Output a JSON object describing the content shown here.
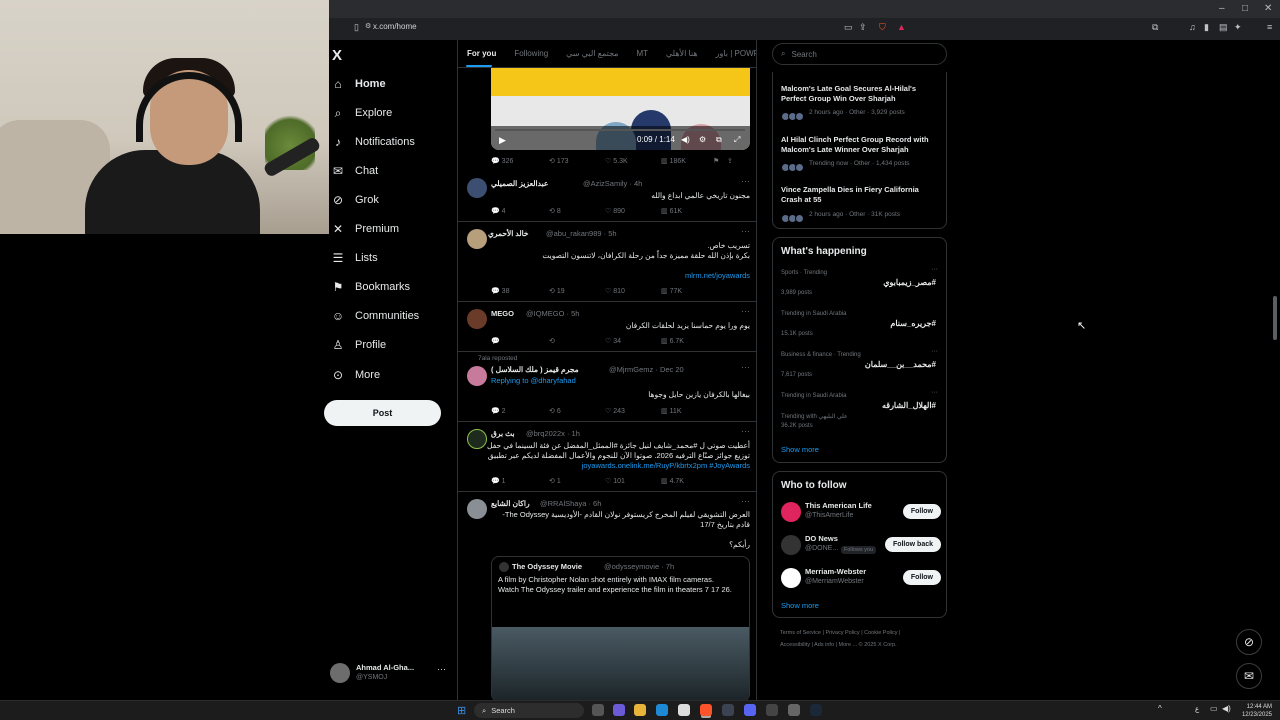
{
  "browser": {
    "url": "x.com/home"
  },
  "nav": {
    "logo": "X",
    "items": [
      {
        "label": "Home",
        "icon": "home-icon"
      },
      {
        "label": "Explore",
        "icon": "search-icon"
      },
      {
        "label": "Notifications",
        "icon": "bell-icon",
        "badge": "1"
      },
      {
        "label": "Chat",
        "icon": "mail-icon"
      },
      {
        "label": "Grok",
        "icon": "grok-icon"
      },
      {
        "label": "Premium",
        "icon": "x-icon"
      },
      {
        "label": "Lists",
        "icon": "list-icon"
      },
      {
        "label": "Bookmarks",
        "icon": "bookmark-icon"
      },
      {
        "label": "Communities",
        "icon": "people-icon"
      },
      {
        "label": "Profile",
        "icon": "person-icon"
      },
      {
        "label": "More",
        "icon": "more-circle-icon"
      }
    ],
    "post_label": "Post",
    "account": {
      "name": "Ahmad Al-Gha...",
      "handle": "@YSMOJ"
    }
  },
  "tabs": [
    "For you",
    "Following",
    "مجتمع البي سي",
    "MT",
    "هنا الأهلي",
    "باور | POWR"
  ],
  "video": {
    "time": "0:09 / 1:14"
  },
  "video_stats": {
    "replies": "326",
    "reposts": "173",
    "likes": "5.3K",
    "views": "186K"
  },
  "tweets": [
    {
      "name": "عبدالعزيز الصميلي",
      "handle": "@AzizSamily · 4h",
      "text": "مجنون تاريخي عالمي ابداع والله",
      "stats": {
        "replies": "4",
        "reposts": "8",
        "likes": "890",
        "views": "61K"
      }
    },
    {
      "name": "خالد الأحمري",
      "handle": "@abu_rakan989 · 5h",
      "text1": "تسريب خاص.",
      "text2": "بكرة بإذن الله حلقة مميزة جداً من رحلة الكرافان، لاتنسون التصويت",
      "link": "mlrm.net/joyawards",
      "stats": {
        "replies": "38",
        "reposts": "19",
        "likes": "810",
        "views": "77K"
      }
    },
    {
      "name": "MEGO",
      "handle": "@IQMEGO · 5h",
      "text": "يوم ورا يوم حماسنا يزيد لحلقات الكرفان",
      "stats": {
        "replies": "",
        "reposts": "",
        "likes": "34",
        "views": "6.7K"
      }
    },
    {
      "repost": "7ala reposted",
      "name": "مجرم قيمز ( ملك السلاسل )",
      "handle": "@MjrmGemz · Dec 20",
      "replying": "Replying to @dharyfahad",
      "text": "بيغالها بالكرفان يازين حايل وجوها",
      "stats": {
        "replies": "2",
        "reposts": "6",
        "likes": "243",
        "views": "11K"
      }
    },
    {
      "name": "بث برق",
      "handle": "@brq2022x · 1h",
      "text1": "أعطيت صوتي ل #محمد_شايف لنيل جائزة #الممثل_المفضل عن فئة السينما في حفل",
      "text2": "توزيع جوائز صنّاع الترفيه 2026. صوتوا الآن للنجوم والأعمال المفضلة لديكم عبر تطبيق",
      "link": "joyawards.onelink.me/RuyP/kbrtx2pm #JoyAwards",
      "stats": {
        "replies": "1",
        "reposts": "1",
        "likes": "101",
        "views": "4.7K"
      }
    },
    {
      "name": "راكان الشايع",
      "handle": "@RRAlShaya · 6h",
      "text1": "العرض التشويقي لفيلم المخرج كريستوفر نولان القادم -الأوديسية The Odyssey-",
      "text2": "قادم بتاريخ 17/7",
      "text3": "رأيكم؟",
      "quote": {
        "name": "The Odyssey Movie",
        "handle": "@odysseymovie · 7h",
        "text1": "A film by Christopher Nolan shot entirely with IMAX film cameras.",
        "text2": "Watch The Odyssey trailer and experience the film in theaters 7 17 26."
      }
    }
  ],
  "right": {
    "search_placeholder": "Search",
    "news": [
      {
        "title": "Malcom's Late Goal Secures Al-Hilal's Perfect Group Win Over Sharjah",
        "meta": "2 hours ago · Other · 3,929 posts"
      },
      {
        "title": "Al Hilal Clinch Perfect Group Record with Malcom's Late Winner Over Sharjah",
        "meta": "Trending now · Other · 1,434 posts"
      },
      {
        "title": "Vince Zampella Dies in Fiery California Crash at 55",
        "meta": "2 hours ago · Other · 31K posts"
      }
    ],
    "happening_title": "What's happening",
    "trends": [
      {
        "meta": "Sports · Trending",
        "tag": "#مصر_زيمبابوي",
        "count": "3,989 posts"
      },
      {
        "meta": "Trending in Saudi Arabia",
        "tag": "#جريره_سنام",
        "count": "15.1K posts"
      },
      {
        "meta": "Business & finance · Trending",
        "tag": "#محمد__بن__سلمان",
        "count": "7,617 posts"
      },
      {
        "meta": "Trending in Saudi Arabia",
        "tag": "#الهلال_الشارقه",
        "count": "36.2K posts",
        "with": "Trending with علي البليهي"
      }
    ],
    "show_more": "Show more",
    "who_title": "Who to follow",
    "follow": [
      {
        "name": "This American Life",
        "handle": "@ThisAmerLife",
        "button": "Follow",
        "color": "#e0245e"
      },
      {
        "name": "DO News",
        "handle": "@DONE...",
        "follows": "Follows you",
        "button": "Follow back",
        "color": "#333"
      },
      {
        "name": "Merriam-Webster",
        "handle": "@MerriamWebster",
        "button": "Follow",
        "color": "#ffffff"
      }
    ],
    "footer1": "Terms of Service  |  Privacy Policy  |  Cookie Policy  |",
    "footer2": "Accessibility  |  Ads info  |  More ...  © 2025 X Corp."
  },
  "taskbar": {
    "search": "Search",
    "time": "12:44 AM",
    "date": "12/23/2025",
    "lang": "ع"
  }
}
